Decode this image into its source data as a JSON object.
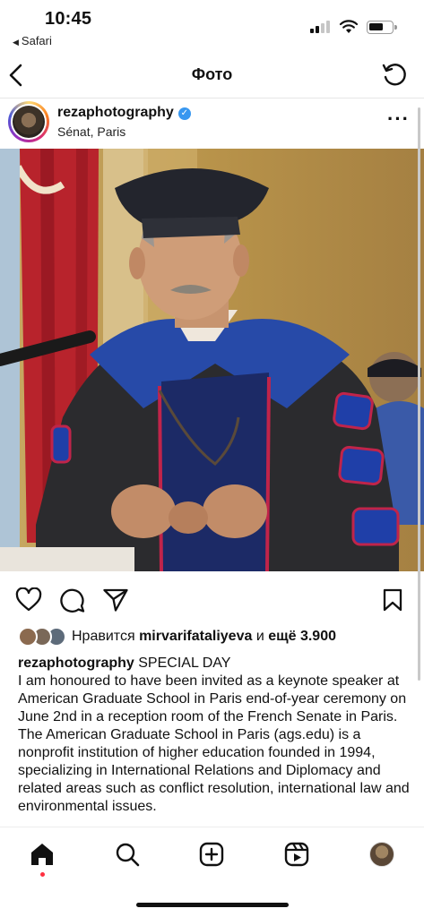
{
  "status_bar": {
    "time": "10:45",
    "back_app": "Safari"
  },
  "header": {
    "title": "Фото"
  },
  "post": {
    "username": "rezaphotography",
    "location": "Sénat, Paris"
  },
  "likes": {
    "prefix": "Нравится",
    "user": "mirvarifataliyeva",
    "connector": "и",
    "more": "ещё 3.900"
  },
  "caption": {
    "user": "rezaphotography",
    "title": "SPECIAL DAY",
    "paragraph1": "I am honoured to have been invited as a keynote speaker at American Graduate School in Paris end-of-year ceremony on June 2nd in a reception room of the French Senate in Paris.",
    "paragraph2": "The  American Graduate School in Paris (ags.edu) is a nonprofit institution of higher education founded in 1994, specializing in International Relations and Diplomacy and related areas such as conflict resolution, international law and environmental issues."
  },
  "icons": {
    "header": [
      "back-chevron-icon",
      "refresh-icon"
    ],
    "actions": [
      "heart-icon",
      "comment-icon",
      "share-icon",
      "bookmark-icon"
    ],
    "nav": [
      "home-icon",
      "search-icon",
      "create-icon",
      "reels-icon",
      "profile-avatar"
    ]
  },
  "colors": {
    "verified": "#3897f0",
    "notification_dot": "#ff3040",
    "gown": "#2b2b2e",
    "velvet_bars": "#1f3fa8"
  }
}
